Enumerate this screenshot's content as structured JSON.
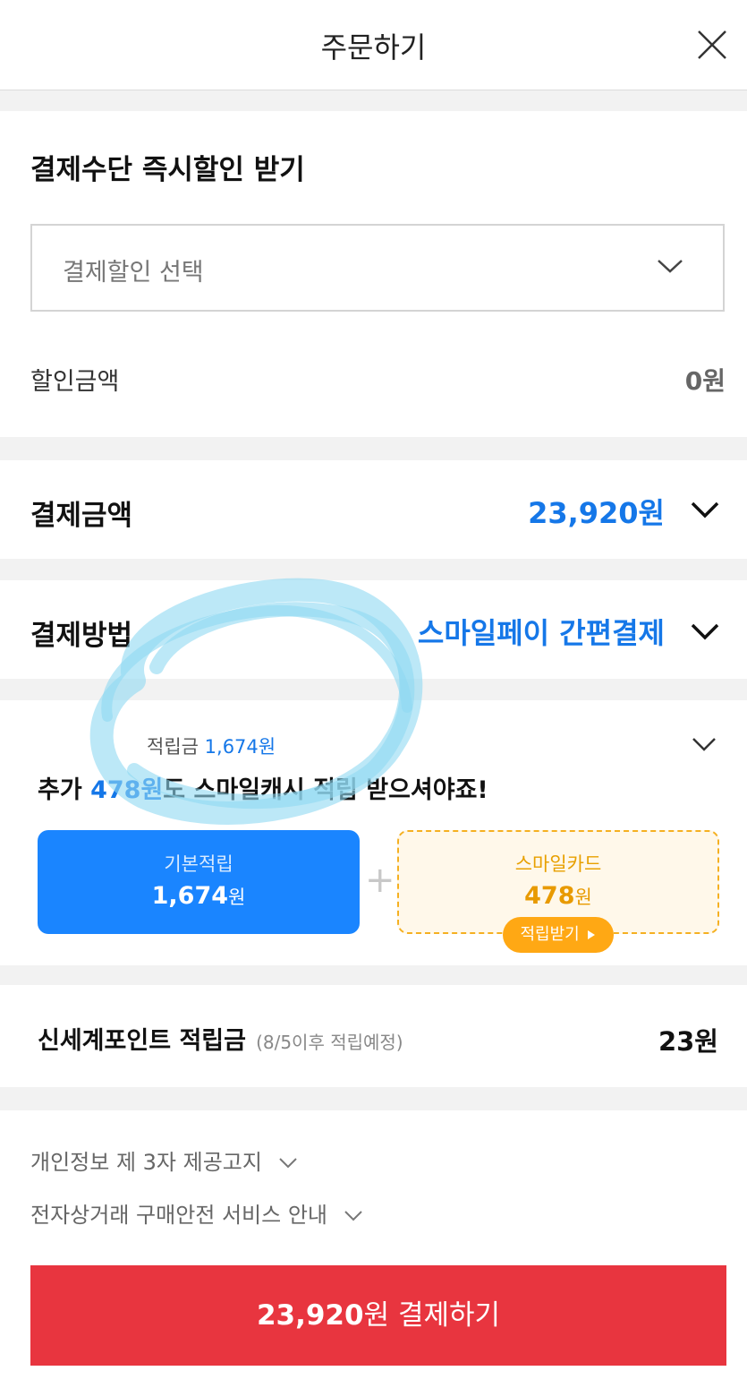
{
  "header": {
    "title": "주문하기"
  },
  "discount": {
    "title": "결제수단 즉시할인 받기",
    "select_placeholder": "결제할인 선택",
    "amount_label": "할인금액",
    "amount_value": "0원"
  },
  "payment_amount": {
    "label": "결제금액",
    "value": "23,920원"
  },
  "payment_method": {
    "label": "결제방법",
    "value": "스마일페이 간편결제"
  },
  "rewards": {
    "label": "적립금",
    "label_amount": "1,674원",
    "headline_prefix": "추가 ",
    "headline_amount": "478원",
    "headline_suffix": "도 스마일캐시 적립 받으셔야죠!",
    "basic": {
      "label": "기본적립",
      "amount": "1,674",
      "unit": "원"
    },
    "card": {
      "label": "스마일카드",
      "amount": "478",
      "unit": "원",
      "button": "적립받기"
    }
  },
  "shinsegae": {
    "label": "신세계포인트 적립금",
    "note": "(8/5이후 적립예정)",
    "value": "23원"
  },
  "notices": [
    {
      "label": "개인정보 제 3자 제공고지"
    },
    {
      "label": "전자상거래 구매안전 서비스 안내"
    }
  ],
  "pay_button": {
    "amount": "23,920",
    "unit": "원",
    "label": " 결제하기"
  },
  "colors": {
    "accent_blue": "#1577e8",
    "pay_red": "#e8353f",
    "smile_orange": "#ffa814"
  }
}
